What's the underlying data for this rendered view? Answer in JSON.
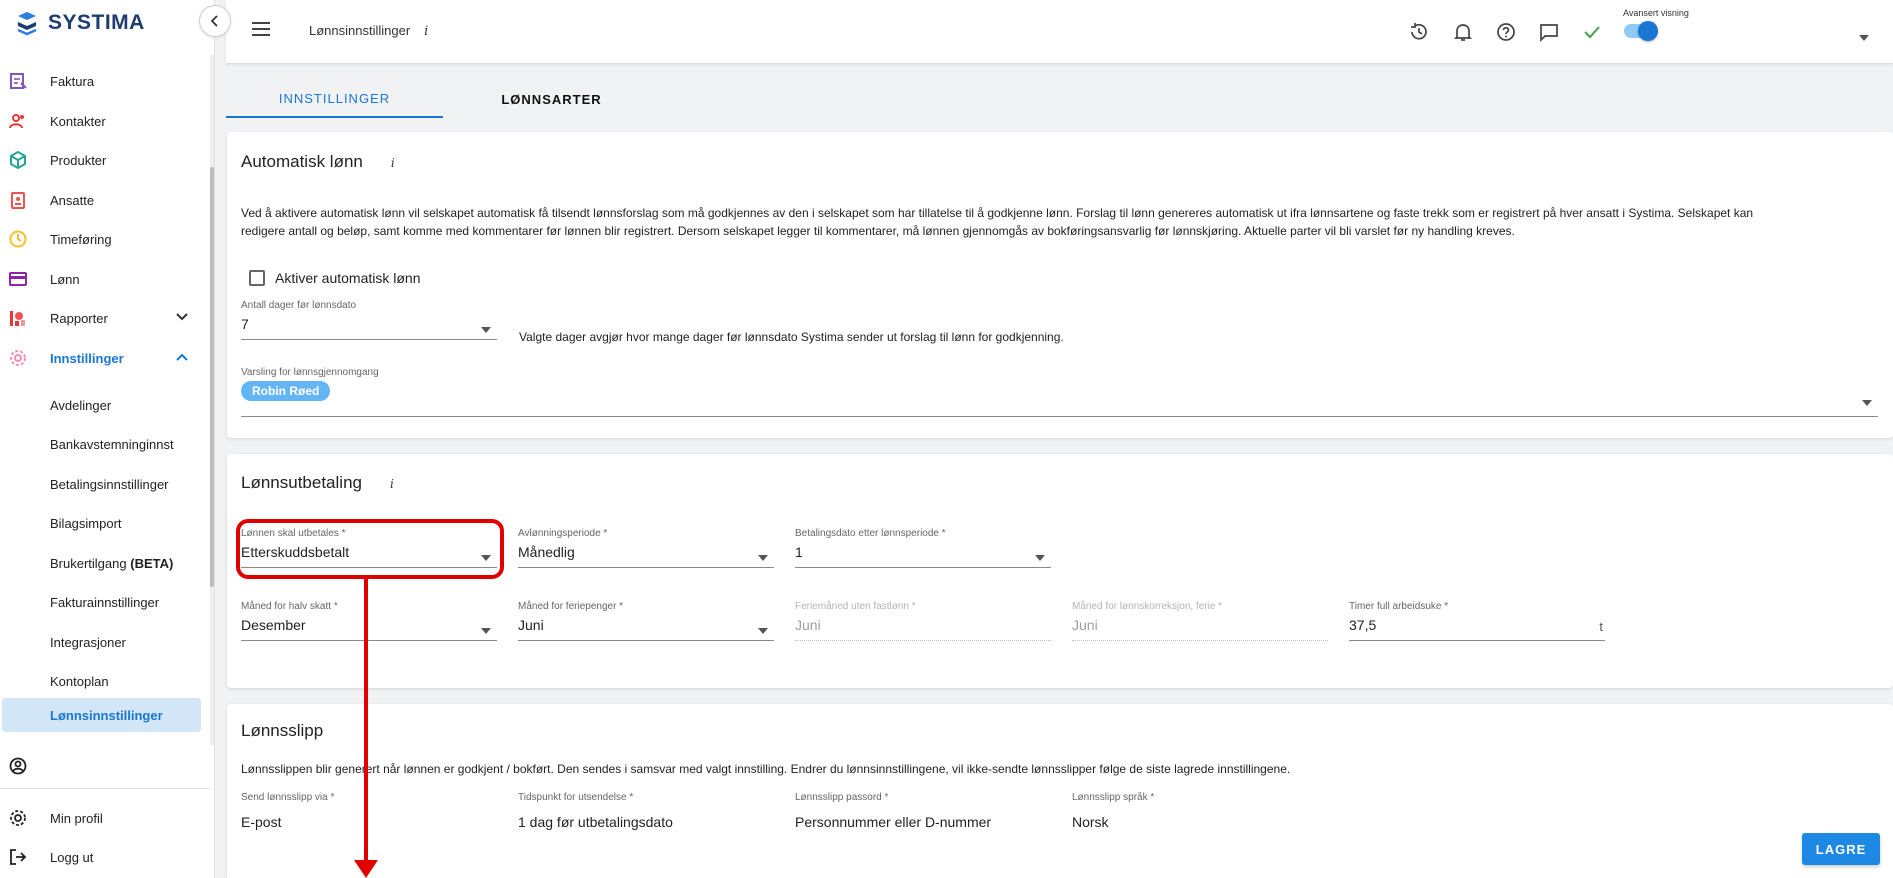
{
  "brand": {
    "name": "SYSTIMA"
  },
  "sidebar": {
    "items": [
      {
        "label": "Faktura",
        "icon": "invoice-icon",
        "color": "#7e57c2"
      },
      {
        "label": "Kontakter",
        "icon": "contacts-icon",
        "color": "#e53935"
      },
      {
        "label": "Produkter",
        "icon": "product-cube-icon",
        "color": "#26a69a"
      },
      {
        "label": "Ansatte",
        "icon": "employee-badge-icon",
        "color": "#ef5350"
      },
      {
        "label": "Timeføring",
        "icon": "clock-icon",
        "color": "#fbc02d"
      },
      {
        "label": "Lønn",
        "icon": "card-icon",
        "color": "#8e24aa"
      },
      {
        "label": "Rapporter",
        "icon": "reports-icon",
        "color": "#e53935"
      },
      {
        "label": "Innstillinger",
        "icon": "gear-icon",
        "color": "#f48fb1"
      }
    ],
    "sub_items": [
      {
        "label": "Avdelinger"
      },
      {
        "label": "Bankavstemninginnst"
      },
      {
        "label": "Betalingsinnstillinger"
      },
      {
        "label": "Bilagsimport"
      },
      {
        "label": "Brukertilgang",
        "suffix": "(BETA)"
      },
      {
        "label": "Fakturainnstillinger"
      },
      {
        "label": "Integrasjoner"
      },
      {
        "label": "Kontoplan"
      },
      {
        "label": "Lønnsinnstillinger"
      }
    ],
    "bottom": [
      {
        "label": "Min profil",
        "icon": "gear-icon"
      },
      {
        "label": "Logg ut",
        "icon": "logout-icon"
      }
    ]
  },
  "header": {
    "title": "Lønnsinnstillinger",
    "info": "i",
    "advanced_view_label": "Avansert visning",
    "advanced_view_on": true
  },
  "tabs": [
    {
      "label": "INNSTILLINGER",
      "active": true
    },
    {
      "label": "LØNNSARTER",
      "active": false
    }
  ],
  "auto_salary": {
    "title": "Automatisk lønn",
    "description_line1": "Ved å aktivere automatisk lønn vil selskapet automatisk få tilsendt lønnsforslag som må godkjennes av den i selskapet som har tillatelse til å godkjenne lønn. Forslag til lønn genereres automatisk ut ifra lønnsartene og faste trekk som er registrert på hver ansatt i Systima. Selskapet kan",
    "description_line2": "redigere antall og beløp, samt komme med kommentarer før lønnen blir registrert. Dersom selskapet legger til kommentarer, må lønnen gjennomgås av bokføringsansvarlig før lønnskjøring. Aktuelle parter vil bli varslet før ny handling kreves.",
    "checkbox_label": "Aktiver automatisk lønn",
    "checkbox_checked": false,
    "days_label": "Antall dager før lønnsdato",
    "days_value": "7",
    "days_note": "Valgte dager avgjør hvor mange dager før lønnsdato Systima sender ut forslag til lønn for godkjenning.",
    "notify_label": "Varsling for lønnsgjennomgang",
    "notify_chip": "Robin Røed"
  },
  "payout": {
    "title": "Lønnsutbetaling",
    "fields": [
      {
        "label": "Lønnen skal utbetales *",
        "value": "Etterskuddsbetalt",
        "disabled": false,
        "dropdown": true
      },
      {
        "label": "Avlønningsperiode *",
        "value": "Månedlig",
        "disabled": false,
        "dropdown": true
      },
      {
        "label": "Betalingsdato etter lønnsperiode *",
        "value": "1",
        "disabled": false,
        "dropdown": true
      },
      {
        "label": "Måned for halv skatt *",
        "value": "Desember",
        "disabled": false,
        "dropdown": true
      },
      {
        "label": "Måned for feriepenger *",
        "value": "Juni",
        "disabled": false,
        "dropdown": true
      },
      {
        "label": "Feriemåned uten fastlønn *",
        "value": "Juni",
        "disabled": true,
        "dropdown": false
      },
      {
        "label": "Måned for lønnskorreksjon, ferie *",
        "value": "Juni",
        "disabled": true,
        "dropdown": false
      },
      {
        "label": "Timer full arbeidsuke *",
        "value": "37,5",
        "suffix": "t",
        "disabled": false,
        "dropdown": false
      }
    ]
  },
  "payslip": {
    "title": "Lønnsslipp",
    "description": "Lønnsslippen blir generert når lønnen er godkjent / bokført. Den sendes i samsvar med valgt innstilling. Endrer du lønnsinnstillingene, vil ikke-sendte lønnsslipper følge de siste lagrede innstillingene.",
    "fields": [
      {
        "label": "Send lønnsslipp via *",
        "value": "E-post"
      },
      {
        "label": "Tidspunkt for utsendelse *",
        "value": "1 dag før utbetalingsdato"
      },
      {
        "label": "Lønnsslipp passord *",
        "value": "Personnummer eller D-nummer"
      },
      {
        "label": "Lønnsslipp språk *",
        "value": "Norsk"
      }
    ]
  },
  "save_label": "LAGRE",
  "colors": {
    "accent": "#1976d2",
    "highlight": "#e00000"
  }
}
